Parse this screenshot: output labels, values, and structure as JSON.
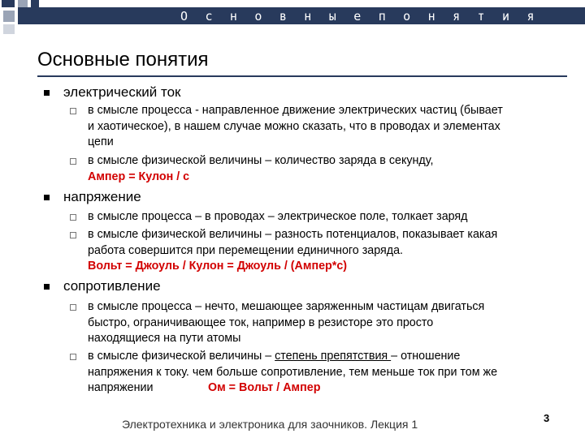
{
  "header": {
    "banner_title": "О с н о в н ы е   п о н я т и я"
  },
  "slide": {
    "title": "Основные понятия",
    "sections": [
      {
        "heading": "электрический ток",
        "items": [
          {
            "lines": [
              "в смысле процесса - направленное движение электрических частиц (бывает",
              "и хаотическое), в нашем случае можно сказать, что в проводах и элементах",
              "цепи"
            ]
          },
          {
            "lines": [
              "в смысле физической величины – количество заряда в секунду,"
            ],
            "formula": "Ампер = Кулон / с"
          }
        ]
      },
      {
        "heading": "напряжение",
        "items": [
          {
            "lines": [
              "в смысле процесса – в проводах – электрическое поле, толкает заряд"
            ]
          },
          {
            "lines": [
              "в смысле физической величины – разность потенциалов, показывает какая",
              "работа совершится при  перемещении единичного заряда."
            ],
            "formula": "Вольт = Джоуль / Кулон = Джоуль / (Ампер*с)"
          }
        ]
      },
      {
        "heading": "сопротивление",
        "items": [
          {
            "lines": [
              "в смысле процесса – нечто, мешающее заряженным частицам двигаться",
              "быстро, ограничивающее ток, например в резисторе это просто",
              "находящиеся на пути атомы"
            ]
          },
          {
            "line1_before": "в смысле физической величины – ",
            "line1_underlined": "степень препятствия ",
            "line1_after": "– отношение",
            "line2": "напряжения к току. чем больше сопротивление, тем меньше ток при том же",
            "line3": "напряжении",
            "formula": "Ом = Вольт / Ампер"
          }
        ]
      }
    ]
  },
  "footer": {
    "text": "Электротехника и электроника для заочников. Лекция 1",
    "page_number": "3"
  }
}
